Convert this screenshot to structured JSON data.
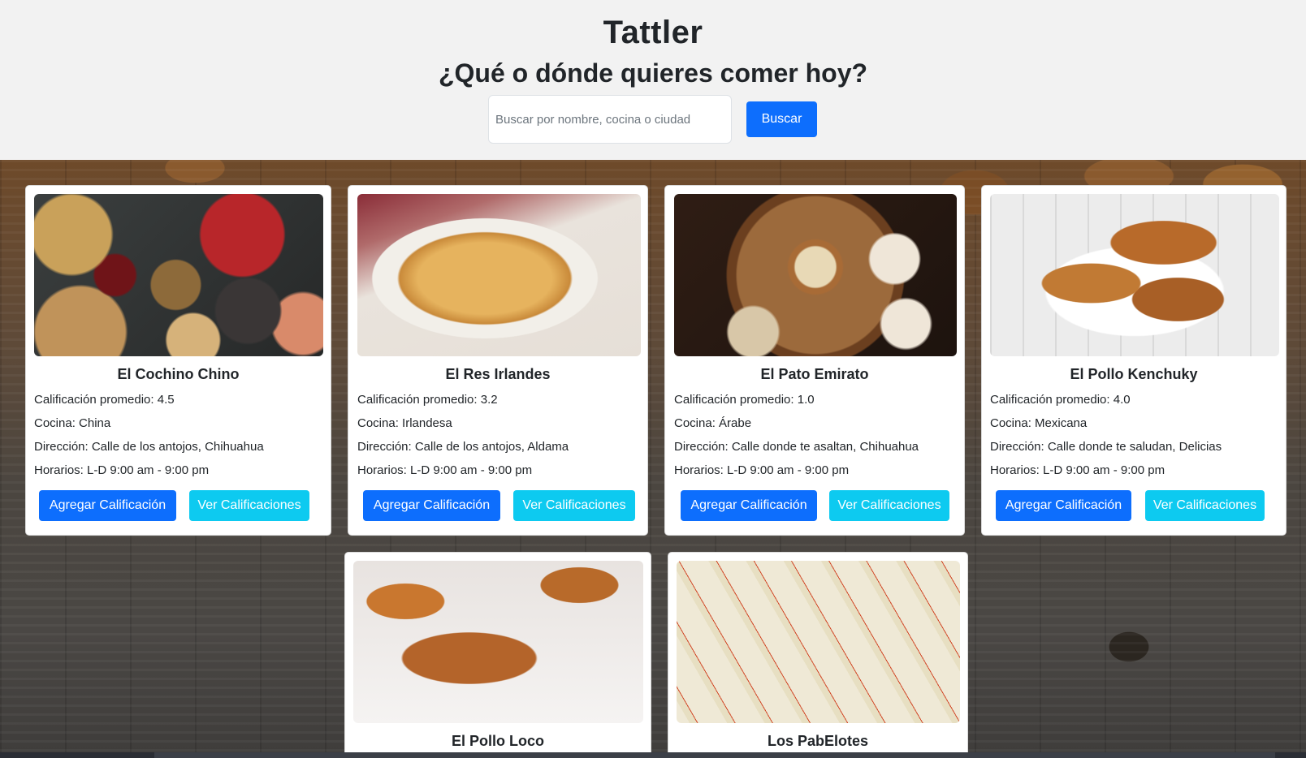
{
  "header": {
    "title": "Tattler",
    "subtitle": "¿Qué o dónde quieres comer hoy?",
    "search_placeholder": "Buscar por nombre, cocina o ciudad",
    "search_button": "Buscar"
  },
  "restaurants": [
    {
      "name": "El Cochino Chino",
      "rating": "Calificación promedio: 4.5",
      "cuisine": "Cocina: China",
      "address": "Dirección: Calle de los antojos, Chihuahua",
      "hours": "Horarios: L-D 9:00 am - 9:00 pm",
      "rate_button": "Agregar Calificación",
      "view_button": "Ver Calificaciones"
    },
    {
      "name": "El Res Irlandes",
      "rating": "Calificación promedio: 3.2",
      "cuisine": "Cocina: Irlandesa",
      "address": "Dirección: Calle de los antojos, Aldama",
      "hours": "Horarios: L-D 9:00 am - 9:00 pm",
      "rate_button": "Agregar Calificación",
      "view_button": "Ver Calificaciones"
    },
    {
      "name": "El Pato Emirato",
      "rating": "Calificación promedio: 1.0",
      "cuisine": "Cocina: Árabe",
      "address": "Dirección: Calle donde te asaltan, Chihuahua",
      "hours": "Horarios: L-D 9:00 am - 9:00 pm",
      "rate_button": "Agregar Calificación",
      "view_button": "Ver Calificaciones"
    },
    {
      "name": "El Pollo Kenchuky",
      "rating": "Calificación promedio: 4.0",
      "cuisine": "Cocina: Mexicana",
      "address": "Dirección: Calle donde te saludan, Delicias",
      "hours": "Horarios: L-D 9:00 am - 9:00 pm",
      "rate_button": "Agregar Calificación",
      "view_button": "Ver Calificaciones"
    },
    {
      "name": "El Pollo Loco"
    },
    {
      "name": "Los PabElotes"
    }
  ],
  "colors": {
    "primary": "#0d6efd",
    "info": "#0dcaf0",
    "header_bg": "#f2f2f2"
  }
}
